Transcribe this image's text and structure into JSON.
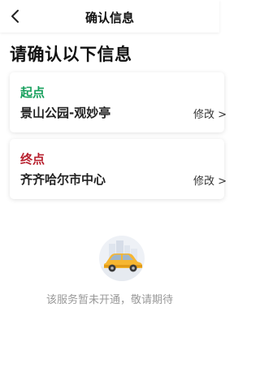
{
  "colors": {
    "start_label": "#17a05d",
    "end_label": "#b8202e",
    "page_bg": "#ffffff",
    "hint_text": "#999999"
  },
  "header": {
    "back_icon": "chevron-left-icon",
    "title": "确认信息"
  },
  "main": {
    "headline": "请确认以下信息",
    "start": {
      "label": "起点",
      "value": "景山公园-观妙亭",
      "edit_label": "修改 >"
    },
    "end": {
      "label": "终点",
      "value": "齐齐哈尔市中心",
      "edit_label": "修改 >"
    },
    "empty_state": {
      "icon": "taxi-car-illustration",
      "message": "该服务暂未开通，敬请期待"
    }
  }
}
